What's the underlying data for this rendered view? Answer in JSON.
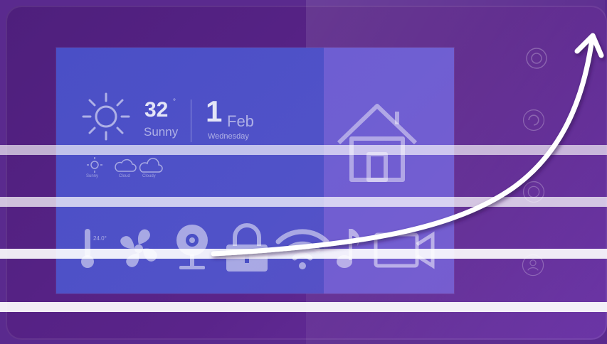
{
  "weather": {
    "temperature": "32",
    "degree_symbol": "°",
    "condition": "Sunny",
    "forecast": [
      {
        "label": "Sunny",
        "icon": "sun-small-icon"
      },
      {
        "label": "Cloud",
        "icon": "cloud-icon"
      },
      {
        "label": "Cloudy",
        "icon": "cloudy-icon"
      }
    ]
  },
  "date": {
    "day": "1",
    "month": "Feb",
    "weekday": "Wednesday"
  },
  "home_icon": "house-icon",
  "device_icons": [
    "thermometer-icon",
    "fan-icon",
    "camera-icon",
    "lock-icon",
    "wifi-icon",
    "music-icon",
    "video-icon"
  ],
  "side_buttons": [
    "power-button",
    "refresh-button",
    "home-button",
    "user-button"
  ],
  "thermometer_label": "24.0°",
  "colors": {
    "frame": "#5a248a",
    "screen": "#4a4fc6",
    "overlay_stripes": "#ffffff"
  }
}
